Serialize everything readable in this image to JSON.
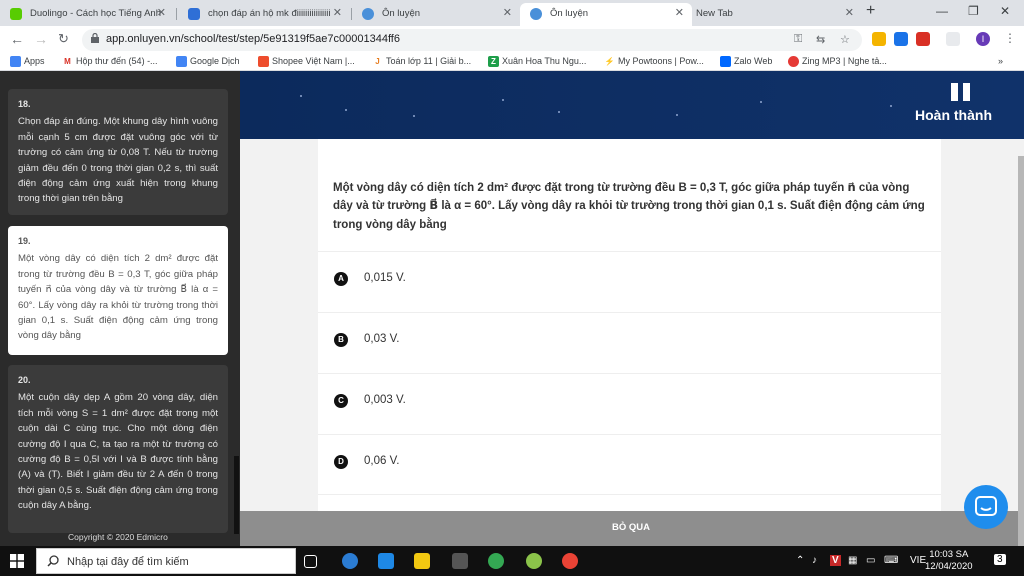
{
  "browser": {
    "tabs": [
      {
        "label": "Duolingo - Cách học Tiếng Anh",
        "icon": "duolingo-icon"
      },
      {
        "label": "chọn đáp án hộ mk điiiiiiiiiiiiiiii",
        "icon": "hoidap-icon"
      },
      {
        "label": "Ôn luyện",
        "icon": "onluyen-icon"
      },
      {
        "label": "Ôn luyện",
        "icon": "onluyen-icon",
        "active": true
      },
      {
        "label": "New Tab",
        "icon": ""
      }
    ],
    "url": "app.onluyen.vn/school/test/step/5e91319f5ae7c00001344ff6",
    "bookmarks": [
      "Apps",
      "Hộp thư đến (54) -...",
      "Google Dịch",
      "Shopee Việt Nam |...",
      "Toán lớp 11 | Giải b...",
      "Xuân Hoa Thu Ngu...",
      "My Powtoons | Pow...",
      "Zalo Web",
      "Zing MP3 | Nghe tả..."
    ],
    "profile_initial": "I",
    "more_bookmarks": "»"
  },
  "sidebar": {
    "questions": [
      {
        "num": "18.",
        "text": "Chọn đáp án đúng. Một khung dây hình vuông mỗi cạnh 5 cm được đặt vuông góc với từ trường có cảm ứng từ 0,08 T. Nếu từ trường giảm đều đến 0 trong thời gian 0,2 s, thì suất điện động cảm ứng xuất hiện trong khung trong thời gian trên bằng"
      },
      {
        "num": "19.",
        "text": "Một vòng dây có diện tích 2 dm² được đặt trong từ trường đều B = 0,3 T, góc giữa pháp tuyến n⃗ của vòng dây và từ trường B⃗ là α = 60°. Lấy vòng dây ra khỏi từ trường trong thời gian 0,1 s. Suất điện động cảm ứng trong vòng dây bằng"
      },
      {
        "num": "20.",
        "text": "Một cuộn dây dẹp A gồm 20 vòng dây, diện tích mỗi vòng S = 1 dm² được đặt trong một cuộn dài C cùng trục. Cho một dòng điện cường độ I qua C, ta tạo ra một từ trường có cường độ B = 0,5I với I và B được tính bằng (A) và (T). Biết I giảm đều từ 2 A đến 0 trong thời gian 0,5 s. Suất điện động cảm ứng trong cuộn dây A bằng."
      }
    ],
    "copyright": "Copyright © 2020 Edmicro"
  },
  "header": {
    "done_label": "Hoàn thành"
  },
  "question": {
    "text": "Một vòng dây có diện tích 2 dm² được đặt trong từ trường đều B = 0,3 T, góc giữa pháp tuyến n⃗ của vòng dây và từ trường B⃗ là α = 60°. Lấy vòng dây ra khỏi từ trường trong thời gian 0,1 s. Suất điện động cảm ứng trong vòng dây bằng",
    "options": [
      {
        "letter": "A",
        "text": "0,015 V."
      },
      {
        "letter": "B",
        "text": "0,03 V."
      },
      {
        "letter": "C",
        "text": "0,003 V."
      },
      {
        "letter": "D",
        "text": "0,06 V."
      }
    ]
  },
  "skip_label": "BỎ QUA",
  "taskbar": {
    "search_placeholder": "Nhập tại đây để tìm kiếm",
    "language": "VIE",
    "time": "10:03 SA",
    "date": "12/04/2020",
    "notifications": "3"
  }
}
